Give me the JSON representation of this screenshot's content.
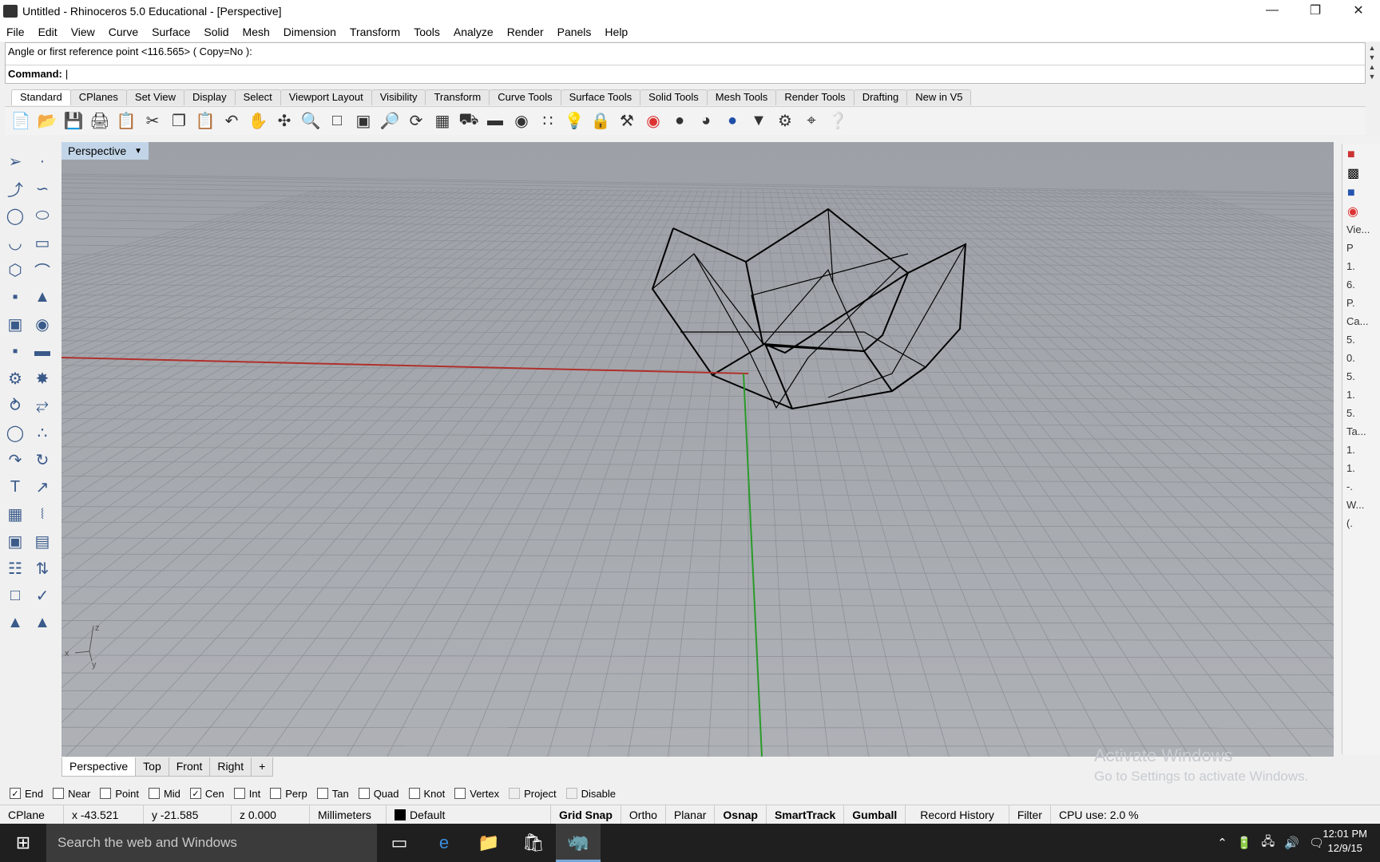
{
  "window": {
    "title": "Untitled - Rhinoceros 5.0 Educational - [Perspective]"
  },
  "menus": [
    "File",
    "Edit",
    "View",
    "Curve",
    "Surface",
    "Solid",
    "Mesh",
    "Dimension",
    "Transform",
    "Tools",
    "Analyze",
    "Render",
    "Panels",
    "Help"
  ],
  "command": {
    "history": "Angle or first reference point <116.565> ( Copy=No ):",
    "prompt": "Command:"
  },
  "tabs": [
    "Standard",
    "CPlanes",
    "Set View",
    "Display",
    "Select",
    "Viewport Layout",
    "Visibility",
    "Transform",
    "Curve Tools",
    "Surface Tools",
    "Solid Tools",
    "Mesh Tools",
    "Render Tools",
    "Drafting",
    "New in V5"
  ],
  "viewport": {
    "label": "Perspective",
    "axis_labels": {
      "z": "z",
      "x": "x",
      "y": "y"
    }
  },
  "view_tabs": [
    "Perspective",
    "Top",
    "Front",
    "Right",
    "+"
  ],
  "right_panel": [
    "Vie...",
    "P",
    "1.",
    "6.",
    "P.",
    "Ca...",
    "5.",
    "0.",
    "5.",
    "1.",
    "5.",
    "Ta...",
    "1.",
    "1.",
    "-.",
    "W...",
    "(."
  ],
  "osnaps": [
    {
      "label": "End",
      "checked": true
    },
    {
      "label": "Near",
      "checked": false
    },
    {
      "label": "Point",
      "checked": false
    },
    {
      "label": "Mid",
      "checked": false
    },
    {
      "label": "Cen",
      "checked": true
    },
    {
      "label": "Int",
      "checked": false
    },
    {
      "label": "Perp",
      "checked": false
    },
    {
      "label": "Tan",
      "checked": false
    },
    {
      "label": "Quad",
      "checked": false
    },
    {
      "label": "Knot",
      "checked": false
    },
    {
      "label": "Vertex",
      "checked": false
    },
    {
      "label": "Project",
      "checked": false
    },
    {
      "label": "Disable",
      "checked": false
    }
  ],
  "status": {
    "cplane": "CPlane",
    "x": "x -43.521",
    "y": "y -21.585",
    "z": "z 0.000",
    "units": "Millimeters",
    "layer": "Default",
    "grid_snap": "Grid Snap",
    "ortho": "Ortho",
    "planar": "Planar",
    "osnap": "Osnap",
    "smarttrack": "SmartTrack",
    "gumball": "Gumball",
    "record_history": "Record History",
    "filter": "Filter",
    "cpu": "CPU use: 2.0 %"
  },
  "watermark": {
    "line1": "Activate Windows",
    "line2": "Go to Settings to activate Windows."
  },
  "taskbar": {
    "search_placeholder": "Search the web and Windows",
    "time": "12:01 PM",
    "date": "12/9/15"
  }
}
